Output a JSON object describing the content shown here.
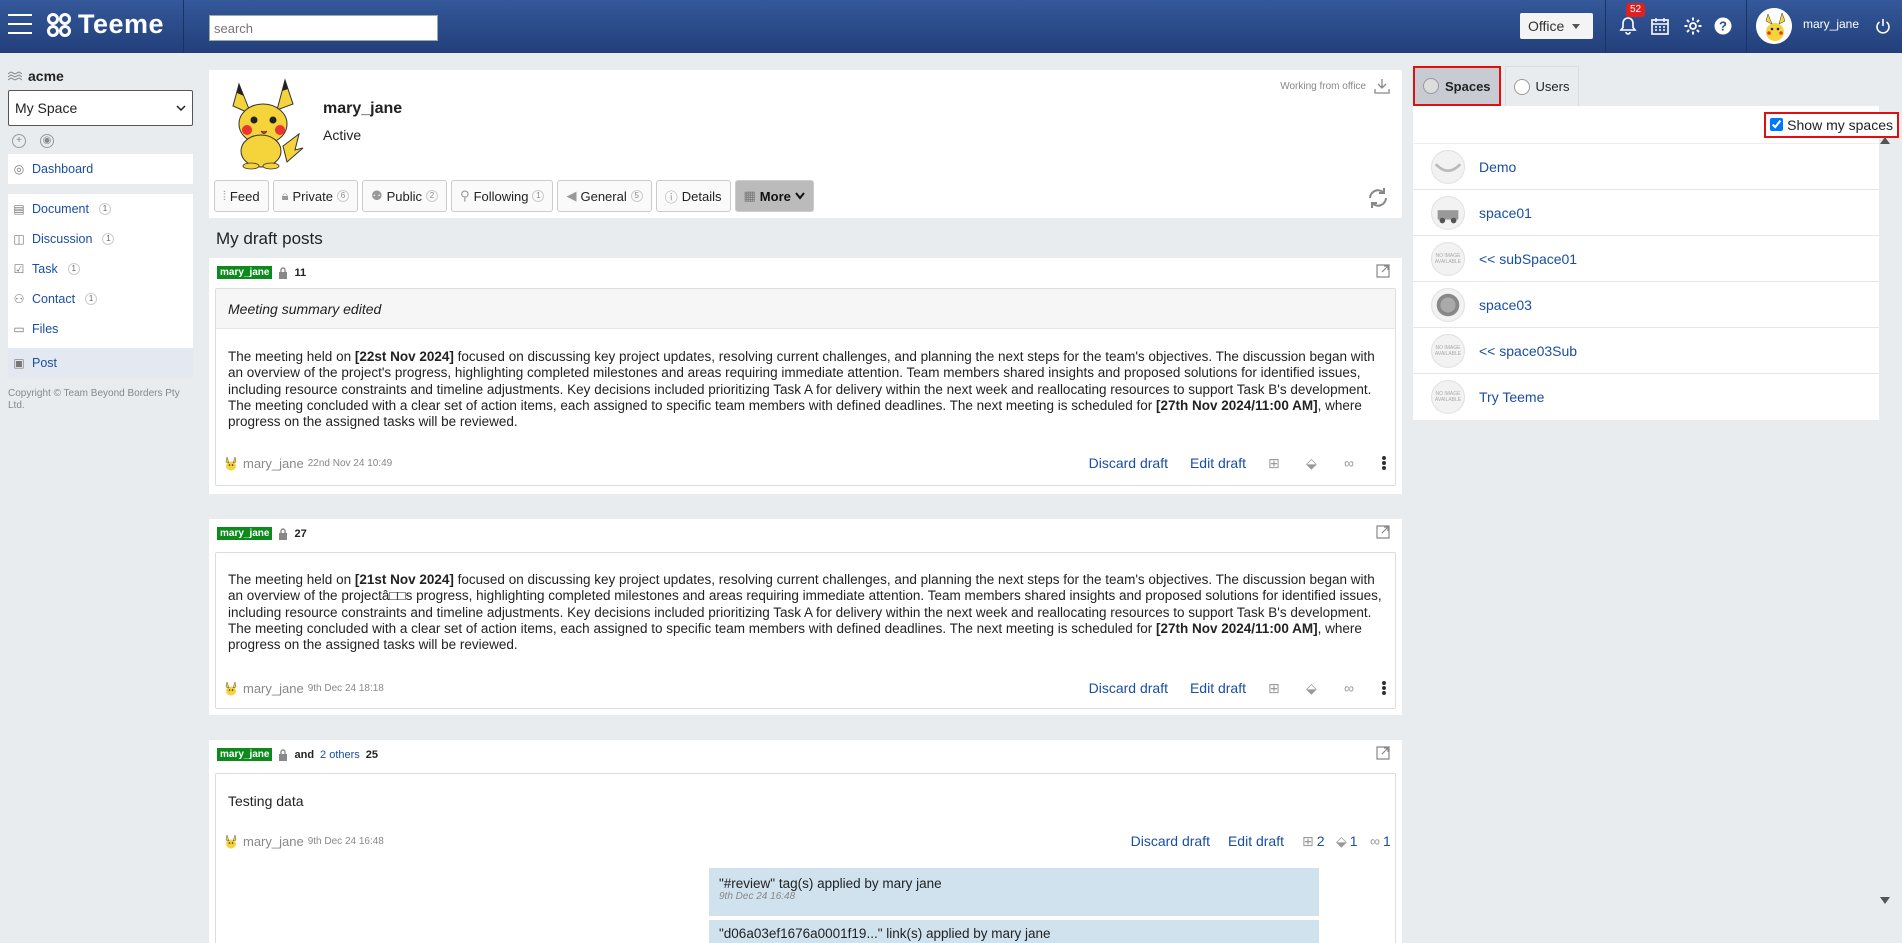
{
  "topbar": {
    "brand": "Teeme",
    "search_placeholder": "search",
    "office_label": "Office",
    "notification_count": "52",
    "username": "mary_jane"
  },
  "sidebar": {
    "org": "acme",
    "space_selected": "My Space",
    "items": [
      {
        "label": "Dashboard",
        "icon": "compass-icon",
        "count": ""
      },
      {
        "label": "Document",
        "icon": "document-icon",
        "count": "1"
      },
      {
        "label": "Discussion",
        "icon": "discussion-icon",
        "count": "1"
      },
      {
        "label": "Task",
        "icon": "checkbox-icon",
        "count": "1"
      },
      {
        "label": "Contact",
        "icon": "handshake-icon",
        "count": "1"
      },
      {
        "label": "Files",
        "icon": "folder-icon",
        "count": ""
      },
      {
        "label": "Post",
        "icon": "post-icon",
        "count": ""
      }
    ],
    "copyright": "Copyright © Team Beyond Borders Pty Ltd."
  },
  "profile": {
    "name": "mary_jane",
    "status": "Active",
    "working_from": "Working from office",
    "tabs": [
      {
        "label": "Feed",
        "count": ""
      },
      {
        "label": "Private",
        "count": "6"
      },
      {
        "label": "Public",
        "count": "2"
      },
      {
        "label": "Following",
        "count": "1"
      },
      {
        "label": "General",
        "count": "5"
      },
      {
        "label": "Details",
        "count": ""
      },
      {
        "label": "More",
        "count": ""
      }
    ]
  },
  "main": {
    "section_title": "My draft posts",
    "posts": [
      {
        "user": "mary_jane",
        "count": "11",
        "summary": "Meeting summary edited",
        "t1": "The meeting held on ",
        "b1": "[22st Nov 2024]",
        "t2": " focused on discussing key project updates, resolving current challenges, and planning the next steps for the team's objectives. The discussion began with an overview of the project's progress, highlighting completed milestones and areas requiring immediate attention. Team members shared insights and proposed solutions for identified issues, including resource constraints and timeline adjustments. Key decisions included prioritizing Task A for delivery within the next week and reallocating resources to support Task B's development. The meeting concluded with a clear set of action items, each assigned to specific team members with defined deadlines. The next meeting is scheduled for ",
        "b2": "[27th Nov 2024/11:00 AM]",
        "t3": ", where progress on the assigned tasks will be reviewed.",
        "author": "mary_jane",
        "date": "22nd Nov 24 10:49",
        "discard": "Discard draft",
        "edit": "Edit draft"
      },
      {
        "user": "mary_jane",
        "count": "27",
        "t1": "The meeting held on ",
        "b1": "[21st Nov 2024]",
        "t2": " focused on discussing key project updates, resolving current challenges, and planning the next steps for the team's objectives. The discussion began with an overview of the projectâ□□s progress, highlighting completed milestones and areas requiring immediate attention. Team members shared insights and proposed solutions for identified issues, including resource constraints and timeline adjustments. Key decisions included prioritizing Task A for delivery within the next week and reallocating resources to support Task B's development. The meeting concluded with a clear set of action items, each assigned to specific team members with defined deadlines. The next meeting is scheduled for ",
        "b2": "[27th Nov 2024/11:00 AM]",
        "t3": ", where progress on the assigned tasks will be reviewed.",
        "author": "mary_jane",
        "date": "9th Dec 24 18:18",
        "discard": "Discard draft",
        "edit": "Edit draft"
      },
      {
        "user": "mary_jane",
        "and": "and",
        "others": "2 others",
        "count": "25",
        "text": "Testing data",
        "author": "mary_jane",
        "date": "9th Dec 24 16:48",
        "discard": "Discard draft",
        "edit": "Edit draft",
        "comments": "2",
        "tags": "1",
        "links": "1",
        "activity": [
          {
            "text": "\"#review\" tag(s) applied by mary jane",
            "date": "9th Dec 24 16:48"
          },
          {
            "text": "\"d06a03ef1676a0001f19...\" link(s) applied by mary jane",
            "date": ""
          }
        ]
      }
    ]
  },
  "right_panel": {
    "tabs": [
      "Spaces",
      "Users"
    ],
    "show_my_spaces": "Show my spaces",
    "spaces": [
      "Demo",
      "space01",
      "<< subSpace01",
      "space03",
      "<< space03Sub",
      "Try Teeme"
    ],
    "no_image_text": "NO IMAGE AVAILABLE"
  }
}
